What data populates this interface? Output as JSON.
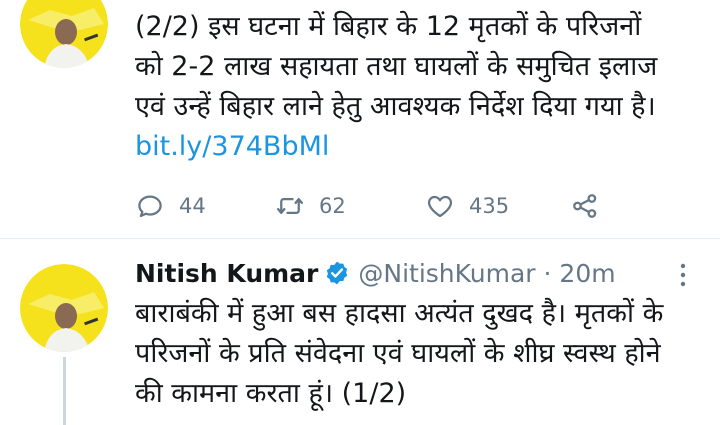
{
  "tweet1": {
    "text": "(2/2) इस घटना में बिहार के 12 मृतकों के परिजनों\nको 2-2 लाख सहायता तथा घायलों के समुचित इलाज\nएवं उन्हें बिहार लाने हेतु आवश्यक निर्देश दिया गया है।",
    "link": "bit.ly/374BbMl",
    "reply_count": "44",
    "retweet_count": "62",
    "like_count": "435"
  },
  "tweet2": {
    "name": "Nitish Kumar",
    "handle": "@NitishKumar · 20m",
    "text": "बाराबंकी में हुआ बस हादसा अत्यंत दुखद है। मृतकों के\nपरिजनों के प्रति संवेदना एवं घायलों के शीघ्र स्वस्थ होने\nकी कामना करता हूं। (1/2)"
  },
  "colors": {
    "accent": "#1b95e0",
    "muted": "#657786",
    "text": "#14171a",
    "avatar_bg": "#f5e21c"
  }
}
